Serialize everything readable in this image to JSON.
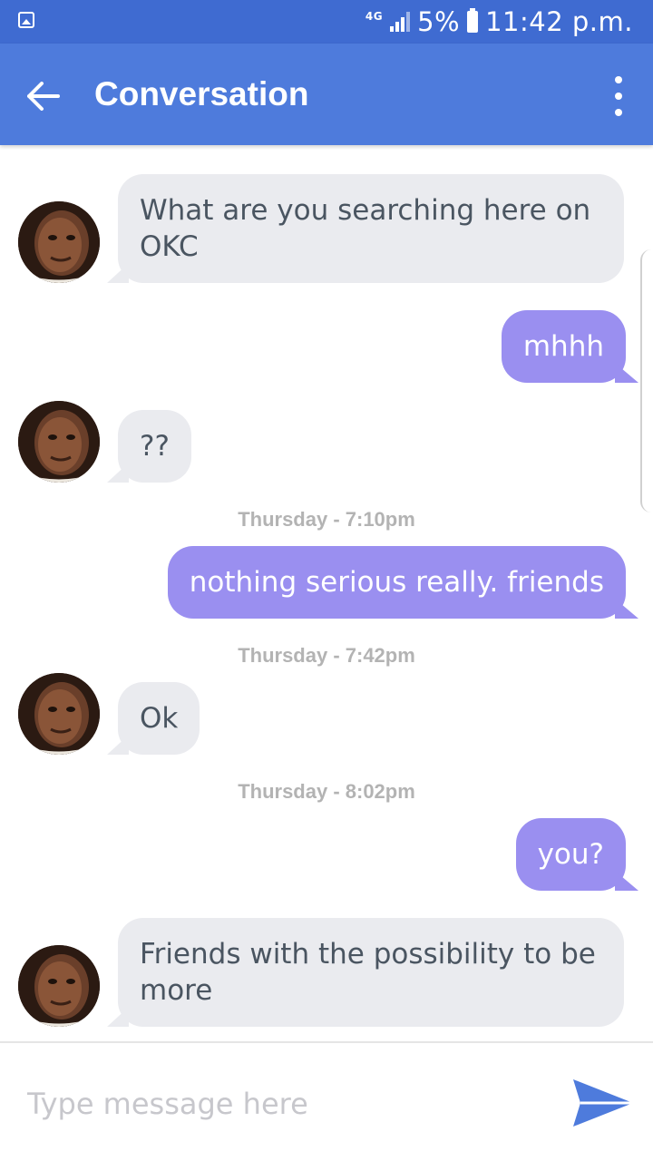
{
  "status_bar": {
    "network": "4G",
    "battery": "5%",
    "time": "11:42 p.m."
  },
  "header": {
    "title": "Conversation"
  },
  "messages": [
    {
      "type": "incoming",
      "text": "What are you searching here on OKC"
    },
    {
      "type": "outgoing",
      "text": "mhhh"
    },
    {
      "type": "incoming",
      "text": "??"
    },
    {
      "type": "timestamp",
      "text": "Thursday - 7:10pm"
    },
    {
      "type": "outgoing",
      "text": "nothing serious really. friends"
    },
    {
      "type": "timestamp",
      "text": "Thursday - 7:42pm"
    },
    {
      "type": "incoming",
      "text": "Ok"
    },
    {
      "type": "timestamp",
      "text": "Thursday - 8:02pm"
    },
    {
      "type": "outgoing",
      "text": "you?"
    },
    {
      "type": "incoming",
      "text": "Friends with the possibility to be more"
    }
  ],
  "composer": {
    "placeholder": "Type message here"
  },
  "colors": {
    "status_bar": "#3f6bd1",
    "app_bar": "#4e7bdc",
    "outgoing_bubble": "#9a8ff0",
    "incoming_bubble": "#eaebef",
    "send_icon": "#4e7bdc"
  },
  "icons": [
    "gallery-icon",
    "signal-icon",
    "battery-icon",
    "back-arrow-icon",
    "more-vert-icon",
    "send-icon"
  ]
}
